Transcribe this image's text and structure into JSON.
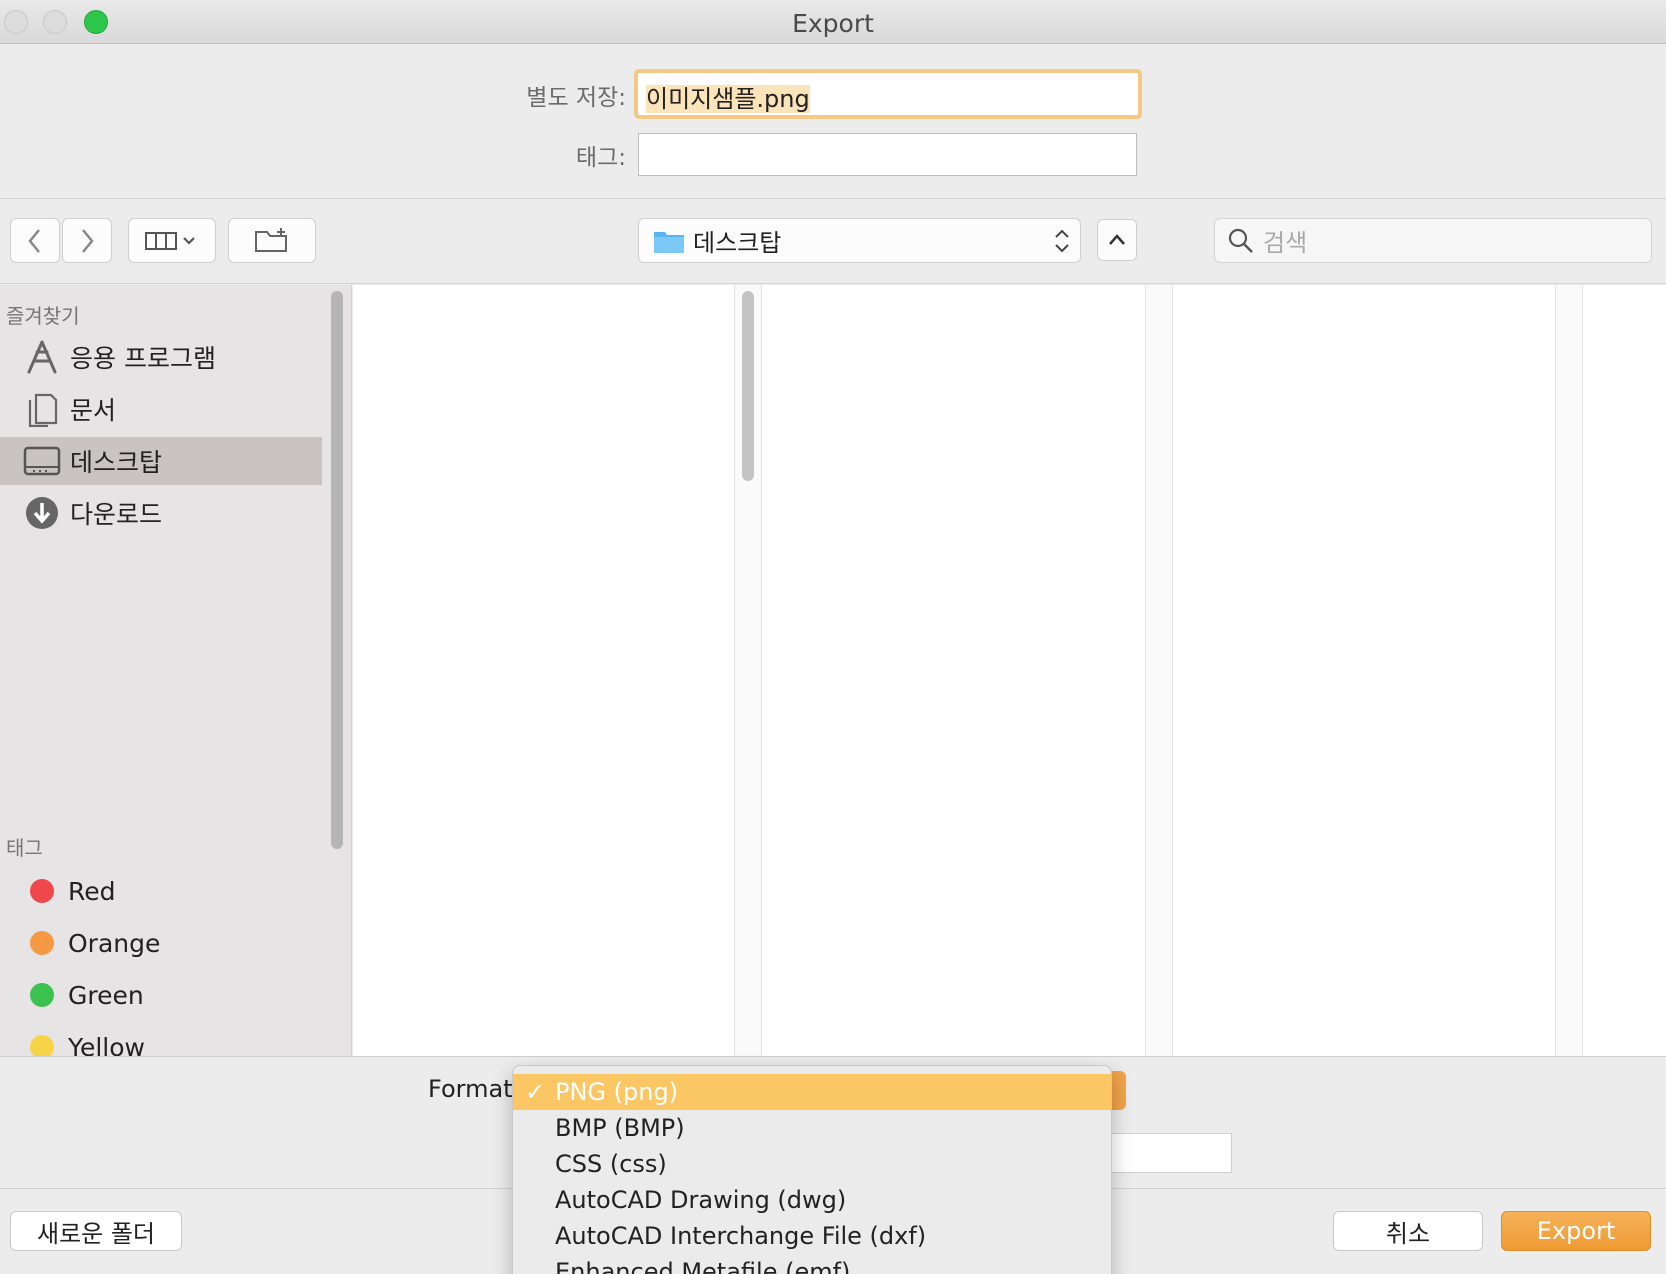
{
  "window": {
    "title": "Export"
  },
  "header": {
    "save_as_label": "별도 저장:",
    "save_as_value": "이미지샘플.png",
    "tags_label": "태그:",
    "tags_value": ""
  },
  "toolbar": {
    "location": "데스크탑",
    "search_placeholder": "검색"
  },
  "sidebar": {
    "favorites_title": "즐겨찾기",
    "favorites": [
      {
        "label": "응용 프로그램",
        "icon": "applications-icon"
      },
      {
        "label": "문서",
        "icon": "documents-icon"
      },
      {
        "label": "데스크탑",
        "icon": "desktop-icon",
        "selected": true
      },
      {
        "label": "다운로드",
        "icon": "downloads-icon"
      }
    ],
    "tags_title": "태그",
    "tags": [
      {
        "label": "Red",
        "color": "#f0484a"
      },
      {
        "label": "Orange",
        "color": "#f59a42"
      },
      {
        "label": "Green",
        "color": "#3cc24f"
      },
      {
        "label": "Yellow",
        "color": "#f6d347"
      }
    ]
  },
  "footer": {
    "format_label": "Format",
    "new_folder": "새로운 폴더",
    "cancel": "취소",
    "export": "Export"
  },
  "format_menu": {
    "selected_index": 0,
    "check_mark": "✓",
    "options": [
      "PNG (png)",
      "BMP (BMP)",
      "CSS (css)",
      "AutoCAD Drawing (dwg)",
      "AutoCAD Interchange File (dxf)",
      "Enhanced Metafile (emf)"
    ]
  },
  "colors": {
    "accent": "#ee9a33",
    "selection": "#fbc765",
    "focus_ring": "#f5c883"
  }
}
